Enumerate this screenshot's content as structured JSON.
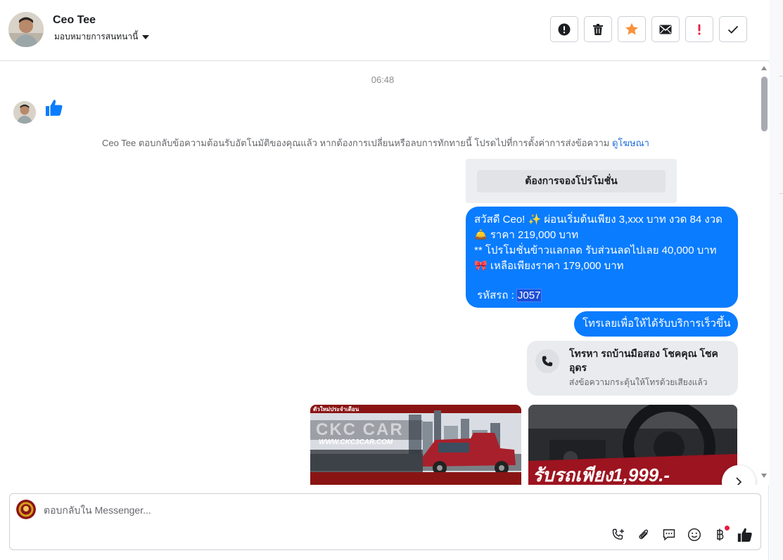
{
  "header": {
    "contact_name": "Ceo Tee",
    "assign_label": "มอบหมายการสนทนานี้",
    "actions": [
      {
        "name": "report-spam-button",
        "icon": "alert-circle-icon"
      },
      {
        "name": "delete-button",
        "icon": "trash-icon"
      },
      {
        "name": "star-button",
        "icon": "star-icon"
      },
      {
        "name": "mark-unread-button",
        "icon": "envelope-icon"
      },
      {
        "name": "follow-up-button",
        "icon": "exclamation-icon"
      },
      {
        "name": "mark-done-button",
        "icon": "check-icon"
      }
    ]
  },
  "conversation": {
    "timestamp": "06:48",
    "customer_like": "thumbs-up-icon",
    "system_notice": "Ceo Tee ตอบกลับข้อความต้อนรับอัตโนมัติของคุณแล้ว หากต้องการเปลี่ยนหรือลบการทักทายนี้ โปรดไปที่การตั้งค่าการส่งข้อความ ",
    "system_notice_link": "ดูโฆษณา",
    "quick_reply": "ต้องการจองโปรโมชั่น",
    "message_lines": [
      "สวัสดี Ceo! ✨  ผ่อนเริ่มต้นเพียง 3,xxx บาท งวด 84 งวด",
      "🛎️ ราคา 219,000 บาท",
      "** โปรโมชั่นข้าวแลกลด รับส่วนลดไปเลย 40,000 บาท",
      "🎀  เหลือเพียงราคา 179,000 บาท",
      ""
    ],
    "car_code_label": " รหัสรถ : ",
    "car_code": "J057",
    "call_prompt": "โทรเลยเพื่อให้ได้รับบริการเร็วขึ้น",
    "call_card_title": "โทรหา รถบ้านมือสอง โชคคุณ โชคอุดร",
    "call_card_subtitle": "ส่งข้อความกระตุ้นให้โทรด้วยเสียงแล้ว",
    "image1_text": {
      "banner": "ตัวใหม่ประจำเดือน",
      "brand": "CKC CAR",
      "url": "WWW.CKC3CAR.COM"
    },
    "image2_text": {
      "price": "รับรถเพียง1,999.-"
    }
  },
  "composer": {
    "placeholder": "ตอบกลับใน Messenger...",
    "tools": [
      "phone-plus-icon",
      "paperclip-icon",
      "saved-reply-icon",
      "emoji-icon",
      "baht-icon",
      "thumbs-up-icon"
    ]
  },
  "colors": {
    "accent": "#0a7cff",
    "star": "#f7923b",
    "follow_up": "#e41e3f"
  }
}
